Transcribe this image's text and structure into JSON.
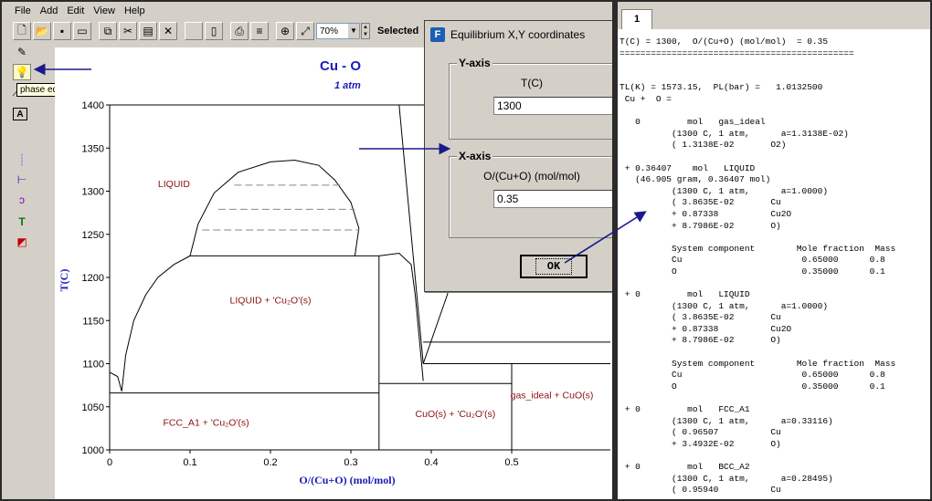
{
  "menu": [
    "File",
    "Add",
    "Edit",
    "View",
    "Help"
  ],
  "toolbar": {
    "zoom_value": "70%",
    "selected_label": "Selected",
    "icons": [
      "new-file-icon",
      "open-folder-icon",
      "save-icon",
      "open-icon",
      "copy-icon",
      "cut-icon",
      "paste-icon",
      "delete-x-icon",
      "blank-icon",
      "print-preview-icon",
      "print-icon",
      "print-setup-icon",
      "zoom-in-icon",
      "fit-icon"
    ]
  },
  "sidebar": {
    "tooltip": "phase equilibrium mode",
    "tools": [
      "pen-icon",
      "bulb-icon",
      "line-icon",
      "text-tool-icon",
      "dotted-line-icon",
      "tie-line-icon",
      "curve-icon",
      "T-icon",
      "shapes-icon"
    ]
  },
  "chart_data": {
    "type": "phase-diagram",
    "title": "Cu - O",
    "subtitle": "1 atm",
    "xlabel": "O/(Cu+O) (mol/mol)",
    "ylabel": "T(C)",
    "xlim": [
      0,
      0.5
    ],
    "ylim": [
      1000,
      1400
    ],
    "x_ticks": [
      "0",
      "0.1",
      "0.2",
      "0.3",
      "0.4",
      "0.5"
    ],
    "y_ticks": [
      "1000",
      "1050",
      "1100",
      "1150",
      "1200",
      "1250",
      "1300",
      "1350",
      "1400"
    ],
    "region_labels": [
      {
        "text": "LIQUID",
        "x": 0.08,
        "y": 1305
      },
      {
        "text": "LIQUID + 'Cu₂O'(s)",
        "x": 0.2,
        "y": 1170
      },
      {
        "text": "FCC_A1 + 'Cu₂O'(s)",
        "x": 0.12,
        "y": 1028
      },
      {
        "text": "CuO(s) + 'Cu₂O'(s)",
        "x": 0.43,
        "y": 1038
      },
      {
        "text": "gas_ideal + CuO(s)",
        "x": 0.55,
        "y": 1060
      }
    ],
    "lines": {
      "miscibility_gap": [
        [
          0.1,
          1225
        ],
        [
          0.11,
          1262
        ],
        [
          0.13,
          1298
        ],
        [
          0.16,
          1322
        ],
        [
          0.2,
          1334
        ],
        [
          0.23,
          1336
        ],
        [
          0.26,
          1330
        ],
        [
          0.28,
          1313
        ],
        [
          0.3,
          1287
        ],
        [
          0.31,
          1257
        ],
        [
          0.305,
          1225
        ]
      ],
      "tie_lines": [
        {
          "x1": 0.155,
          "x2": 0.29,
          "y": 1307
        },
        {
          "x1": 0.135,
          "x2": 0.305,
          "y": 1279
        },
        {
          "x1": 0.115,
          "x2": 0.31,
          "y": 1255
        }
      ],
      "liquidus_left": [
        [
          0.015,
          1068
        ],
        [
          0.02,
          1110
        ],
        [
          0.03,
          1150
        ],
        [
          0.045,
          1180
        ],
        [
          0.06,
          1200
        ],
        [
          0.08,
          1215
        ],
        [
          0.1,
          1225
        ]
      ],
      "eutectic_left_cap": [
        [
          0,
          1090
        ],
        [
          0.01,
          1085
        ],
        [
          0.015,
          1068
        ]
      ],
      "monotectic": [
        [
          0.1,
          1225
        ],
        [
          0.335,
          1225
        ]
      ],
      "cu2o_liquidus_left": [
        [
          0.335,
          1225
        ],
        [
          0.36,
          1228
        ],
        [
          0.375,
          1215
        ],
        [
          0.38,
          1180
        ],
        [
          0.385,
          1130
        ],
        [
          0.39,
          1080
        ]
      ],
      "liquid_boundary_right": [
        [
          0.36,
          1400
        ],
        [
          0.39,
          1100
        ]
      ],
      "tick_right_line": [
        [
          0.39,
          1100
        ],
        [
          0.42,
          1180
        ],
        [
          0.44,
          1260
        ],
        [
          0.445,
          1300
        ]
      ],
      "eutectic_line": [
        [
          0,
          1066
        ],
        [
          0.335,
          1066
        ]
      ],
      "cu2o_line": [
        [
          0.335,
          1000
        ],
        [
          0.335,
          1225
        ]
      ],
      "peritectic_right": [
        [
          0.335,
          1077
        ],
        [
          0.5,
          1077
        ]
      ],
      "cuo_line": [
        [
          0.5,
          1000
        ],
        [
          0.5,
          1100
        ]
      ],
      "top_right_box": [
        [
          0.39,
          1100
        ],
        [
          0.65,
          1100
        ]
      ],
      "upper_horizontal": [
        [
          0.39,
          1125
        ],
        [
          0.65,
          1125
        ]
      ]
    }
  },
  "dialog": {
    "title": "Equilibrium X,Y coordinates",
    "icon": "F",
    "y_group_label": "Y-axis",
    "y_caption": "T(C)",
    "y_value": "1300",
    "x_group_label": "X-axis",
    "x_caption": "O/(Cu+O) (mol/mol)",
    "x_value": "0.35",
    "ok_label": "OK"
  },
  "output": {
    "tab_label": "1",
    "text": "T(C) = 1300,  O/(Cu+O) (mol/mol)  = 0.35\n=============================================\n\n\nTL(K) = 1573.15,  PL(bar) =   1.0132500\n Cu +  O =\n\n   0         mol   gas_ideal\n          (1300 C, 1 atm,      a=1.3138E-02)\n          ( 1.3138E-02       O2)\n\n + 0.36407    mol   LIQUID\n   (46.905 gram, 0.36407 mol)\n          (1300 C, 1 atm,      a=1.0000)\n          ( 3.8635E-02       Cu\n          + 0.87338          Cu2O\n          + 8.7986E-02       O)\n\n          System component        Mole fraction  Mass\n          Cu                       0.65000      0.8\n          O                        0.35000      0.1\n\n + 0         mol   LIQUID\n          (1300 C, 1 atm,      a=1.0000)\n          ( 3.8635E-02       Cu\n          + 0.87338          Cu2O\n          + 8.7986E-02       O)\n\n          System component        Mole fraction  Mass\n          Cu                       0.65000      0.8\n          O                        0.35000      0.1\n\n + 0         mol   FCC_A1\n          (1300 C, 1 atm,      a=0.33116)\n          ( 0.96507          Cu\n          + 3.4932E-02       O)\n\n + 0         mol   BCC_A2\n          (1300 C, 1 atm,      a=0.28495)\n          ( 0.95940          Cu"
  },
  "colors": {
    "chrome": "#d4d0c8",
    "title_blue": "#1b1bb8",
    "region_label": "#8b1010",
    "annotation_arrow": "#1a1a8c"
  }
}
